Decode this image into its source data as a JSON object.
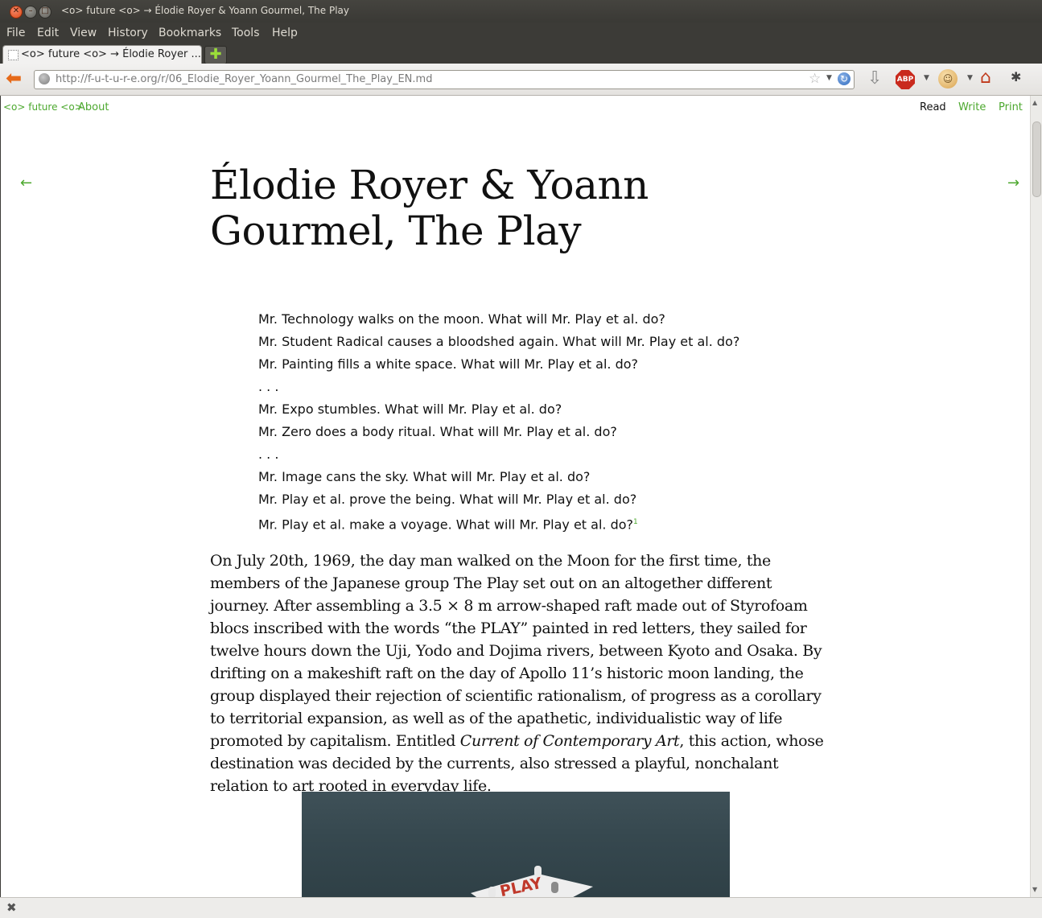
{
  "window": {
    "title": "<o> future <o> → Élodie Royer & Yoann Gourmel, The Play"
  },
  "menu": [
    "File",
    "Edit",
    "View",
    "History",
    "Bookmarks",
    "Tools",
    "Help"
  ],
  "tabs": [
    {
      "label": "<o> future <o> → Élodie Royer ..."
    }
  ],
  "newtab_label": "✚",
  "url": "http://f-u-t-u-r-e.org/r/06_Elodie_Royer_Yoann_Gourmel_The_Play_EN.md",
  "toolbar_icons": [
    "back-icon",
    "globe-icon",
    "bookmark-star-icon",
    "reload-icon",
    "download-icon",
    "adblock-icon",
    "greasemonkey-icon",
    "home-icon",
    "firebug-icon"
  ],
  "abp_label": "ABP",
  "site": {
    "brand": "<o> future <o>",
    "about": "About",
    "read": "Read",
    "write": "Write",
    "print": "Print",
    "prev_arrow": "←",
    "next_arrow": "→"
  },
  "article": {
    "title": "Élodie Royer & Yoann Gourmel, The Play",
    "poem": [
      "Mr. Technology walks on the moon. What will Mr. Play et al. do?",
      "Mr. Student Radical causes a bloodshed again. What will Mr. Play et al. do?",
      "Mr. Painting fills a white space. What will Mr. Play et al. do?",
      ". . .",
      "Mr. Expo stumbles. What will Mr. Play et al. do?",
      "Mr. Zero does a body ritual. What will Mr. Play et al. do?",
      ". . .",
      "Mr. Image cans the sky. What will Mr. Play et al. do?",
      "Mr. Play et al. prove the being. What will Mr. Play et al. do?",
      "Mr. Play et al. make a voyage. What will Mr. Play et al. do?"
    ],
    "footnote_marker": "1",
    "paragraph_part1": "On July 20th, 1969, the day man walked on the Moon for the first time, the members of the Japanese group The Play set out on an altogether different journey. After assembling a 3.5 × 8 m arrow-shaped raft made out of Styrofoam blocs inscribed with the words “the PLAY” painted in red letters, they sailed for twelve hours down the Uji, Yodo and Dojima rivers, between Kyoto and Osaka. By drifting on a makeshift raft on the day of Apollo 11’s historic moon landing, the group displayed their rejection of scientific rationalism, of progress as a corollary to territorial expansion, as well as of the apathetic, individualistic way of life promoted by capitalism. Entitled ",
    "paragraph_italic": "Current of Contemporary Art",
    "paragraph_part2": ", this action, whose destination was decided by the currents, also stressed a playful, nonchalant relation to art rooted in everyday life.",
    "figure_raft_text": "PLAY"
  },
  "statusbar": {
    "close_label": "✖"
  }
}
